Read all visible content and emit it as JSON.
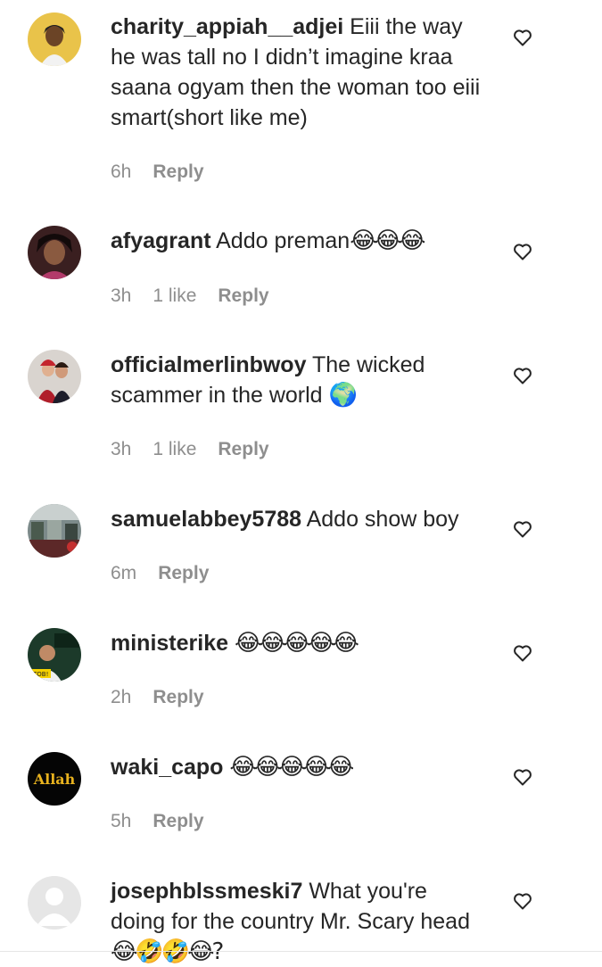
{
  "comments": [
    {
      "username": "charity_appiah__adjei",
      "text": " Eiii the way he was tall no I didn’t imagine kraa saana ogyam then the woman too eiii smart(short like me)",
      "emoji": "",
      "time": "6h",
      "likes": "",
      "reply": "Reply"
    },
    {
      "username": "afyagrant",
      "text": " Addo preman",
      "emoji": "😂😂😂",
      "time": "3h",
      "likes": "1 like",
      "reply": "Reply"
    },
    {
      "username": "officialmerlinbwoy",
      "text": " The wicked scammer in the world ",
      "emoji": "🌍",
      "time": "3h",
      "likes": "1 like",
      "reply": "Reply"
    },
    {
      "username": "samuelabbey5788",
      "text": " Addo show boy",
      "emoji": "",
      "time": "6m",
      "likes": "",
      "reply": "Reply"
    },
    {
      "username": "ministerike",
      "text": " ",
      "emoji": "😂😂😂😂😂",
      "time": "2h",
      "likes": "",
      "reply": "Reply"
    },
    {
      "username": "waki_capo",
      "text": " ",
      "emoji": "😂😂😂😂😂",
      "time": "5h",
      "likes": "",
      "reply": "Reply"
    },
    {
      "username": "josephblssmeski7",
      "text": " What you're doing for the country Mr. Scary head ",
      "emoji": "😂🤣🤣😂?",
      "time": "",
      "likes": "",
      "reply": ""
    }
  ],
  "avatar_text": {
    "ministerike": "TOB!",
    "waki_capo": "Allah"
  },
  "colors": {
    "text": "#262626",
    "meta": "#8e8e8e",
    "heart": "#262626"
  }
}
